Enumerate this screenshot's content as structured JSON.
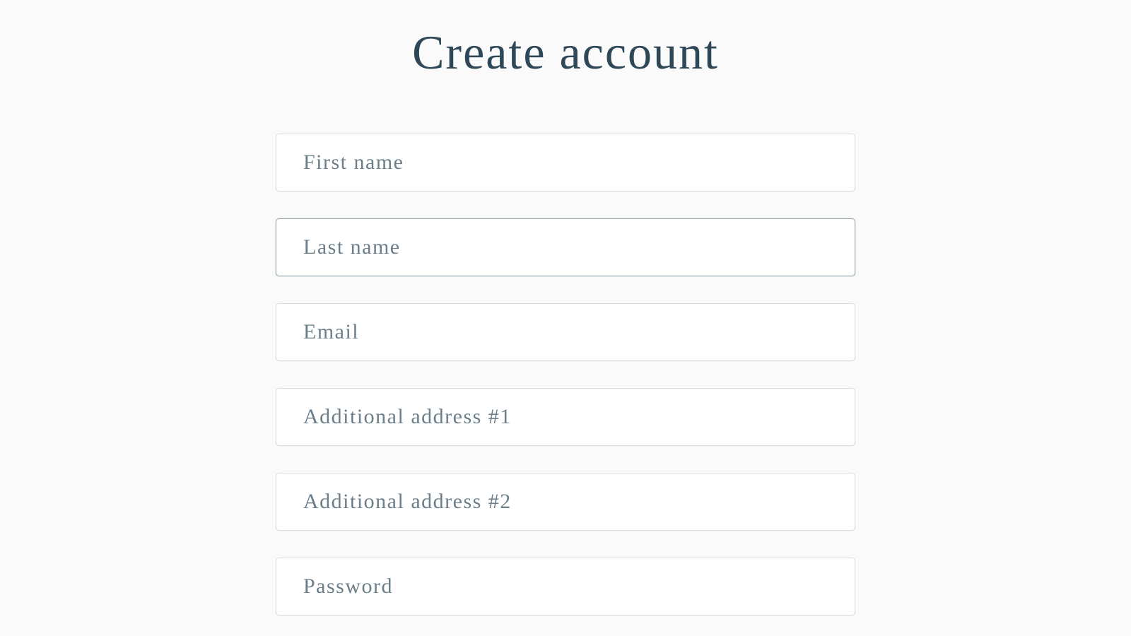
{
  "title": "Create account",
  "fields": {
    "first_name": {
      "placeholder": "First name",
      "value": ""
    },
    "last_name": {
      "placeholder": "Last name",
      "value": ""
    },
    "email": {
      "placeholder": "Email",
      "value": ""
    },
    "addr1": {
      "placeholder": "Additional address #1",
      "value": ""
    },
    "addr2": {
      "placeholder": "Additional address #2",
      "value": ""
    },
    "password": {
      "placeholder": "Password",
      "value": ""
    }
  }
}
